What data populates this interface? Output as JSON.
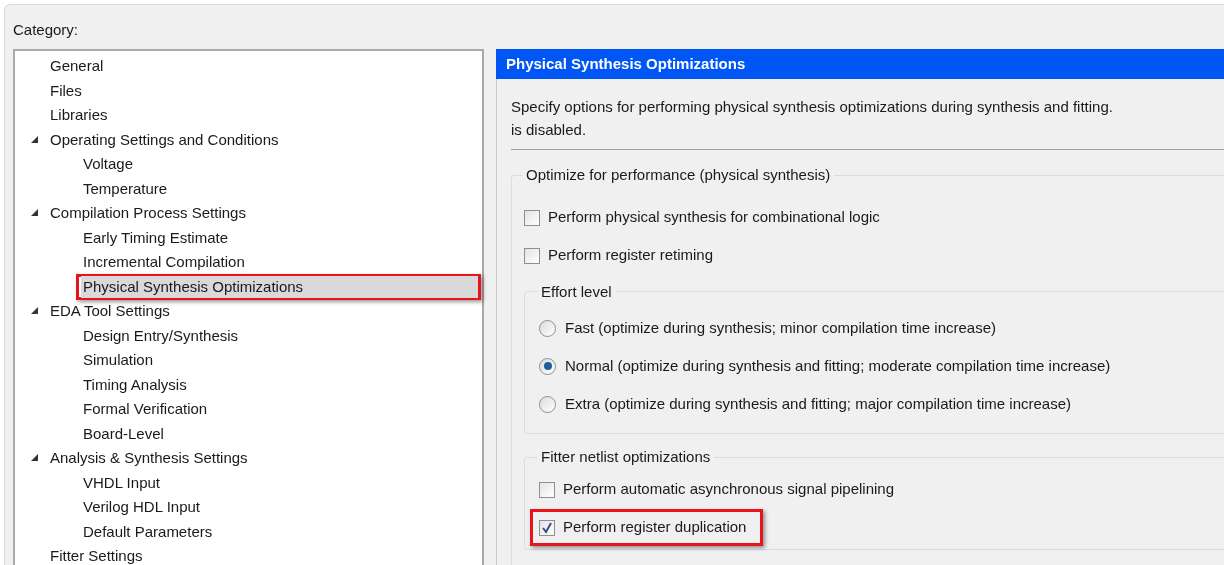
{
  "category_label": "Category:",
  "tree": [
    {
      "label": "General",
      "selected": false
    },
    {
      "label": "Files",
      "selected": false
    },
    {
      "label": "Libraries",
      "selected": false
    },
    {
      "label": "Operating Settings and Conditions",
      "selected": false,
      "expanded": true,
      "children": [
        {
          "label": "Voltage",
          "selected": false
        },
        {
          "label": "Temperature",
          "selected": false
        }
      ]
    },
    {
      "label": "Compilation Process Settings",
      "selected": false,
      "expanded": true,
      "children": [
        {
          "label": "Early Timing Estimate",
          "selected": false
        },
        {
          "label": "Incremental Compilation",
          "selected": false
        },
        {
          "label": "Physical Synthesis Optimizations",
          "selected": true,
          "highlighted": true
        }
      ]
    },
    {
      "label": "EDA Tool Settings",
      "selected": false,
      "expanded": true,
      "children": [
        {
          "label": "Design Entry/Synthesis",
          "selected": false
        },
        {
          "label": "Simulation",
          "selected": false
        },
        {
          "label": "Timing Analysis",
          "selected": false
        },
        {
          "label": "Formal Verification",
          "selected": false
        },
        {
          "label": "Board-Level",
          "selected": false
        }
      ]
    },
    {
      "label": "Analysis & Synthesis Settings",
      "selected": false,
      "expanded": true,
      "children": [
        {
          "label": "VHDL Input",
          "selected": false
        },
        {
          "label": "Verilog HDL Input",
          "selected": false
        },
        {
          "label": "Default Parameters",
          "selected": false
        }
      ]
    },
    {
      "label": "Fitter Settings",
      "selected": false
    }
  ],
  "panel": {
    "title": "Physical Synthesis Optimizations",
    "description": [
      "Specify options for performing physical synthesis optimizations during synthesis and fitting.",
      "is disabled."
    ],
    "group": {
      "title": "Optimize for performance (physical synthesis)",
      "checkboxes": [
        {
          "label": "Perform physical synthesis for combinational logic",
          "checked": false
        },
        {
          "label": "Perform register retiming",
          "checked": false
        }
      ],
      "effort": {
        "title": "Effort level",
        "options": [
          {
            "label": "Fast (optimize during synthesis; minor compilation time increase)",
            "selected": false
          },
          {
            "label": "Normal (optimize during synthesis and fitting; moderate compilation time increase)",
            "selected": true
          },
          {
            "label": "Extra (optimize during synthesis and fitting; major compilation time increase)",
            "selected": false
          }
        ]
      },
      "fitter": {
        "title": "Fitter netlist optimizations",
        "checkboxes": [
          {
            "label": "Perform automatic asynchronous signal pipelining",
            "checked": false,
            "highlighted": false
          },
          {
            "label": "Perform register duplication",
            "checked": true,
            "highlighted": true
          }
        ]
      }
    }
  }
}
